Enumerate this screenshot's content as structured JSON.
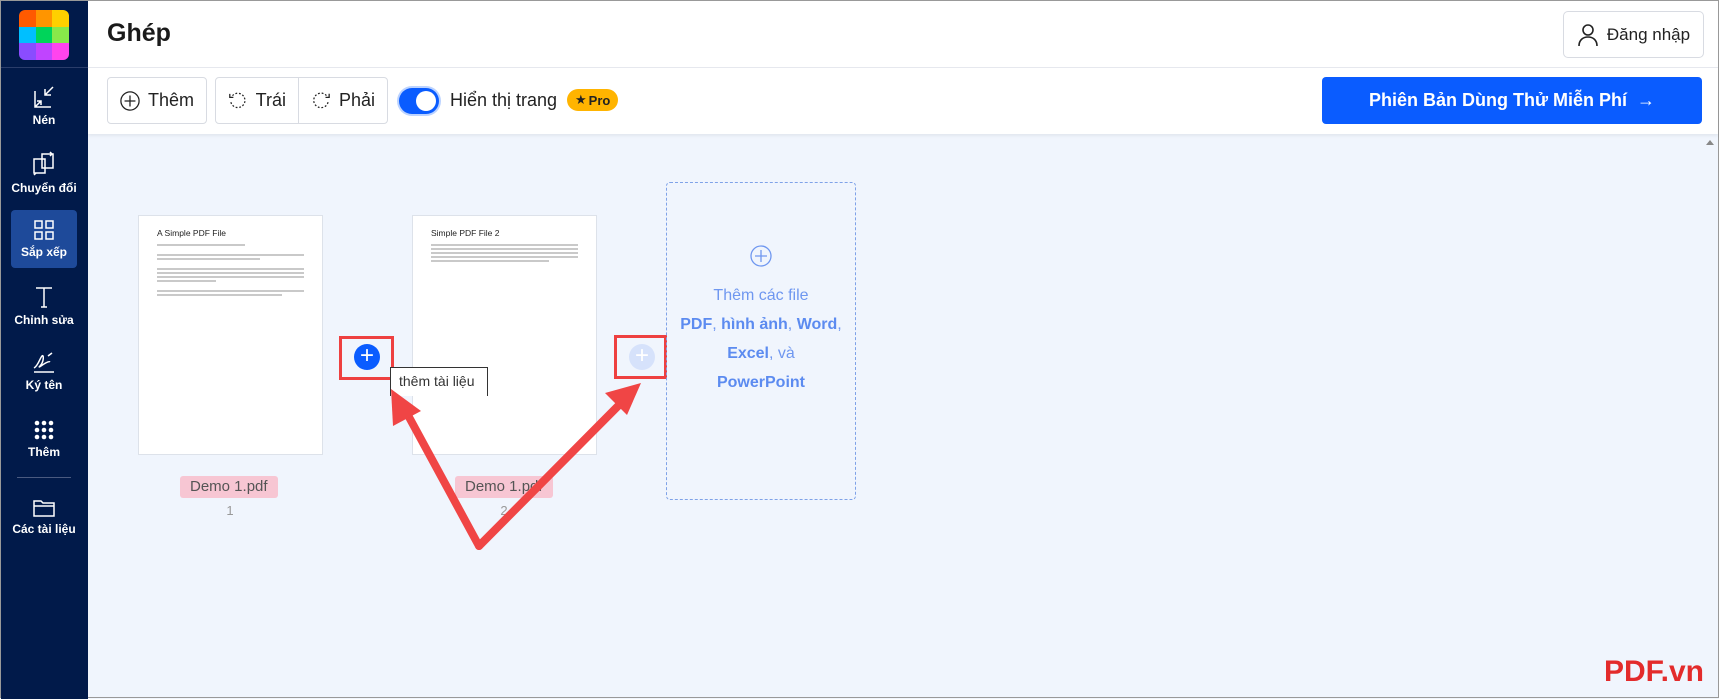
{
  "sidebar": {
    "items": [
      {
        "label": "Nén",
        "icon": "compress-icon"
      },
      {
        "label": "Chuyển đổi",
        "icon": "convert-icon"
      },
      {
        "label": "Sắp xếp",
        "icon": "grid-icon",
        "active": true
      },
      {
        "label": "Chỉnh sửa",
        "icon": "text-icon"
      },
      {
        "label": "Ký tên",
        "icon": "signature-icon"
      },
      {
        "label": "Thêm",
        "icon": "dots-grid-icon"
      },
      {
        "label": "Các tài liệu",
        "icon": "folder-icon"
      }
    ]
  },
  "header": {
    "title": "Ghép",
    "login": "Đăng nhập"
  },
  "toolbar": {
    "add": "Thêm",
    "left": "Trái",
    "right": "Phải",
    "show_pages": "Hiển thị trang",
    "show_pages_on": true,
    "pro": "Pro",
    "trial": "Phiên Bản Dùng Thử Miễn Phí"
  },
  "pages": [
    {
      "title": "A Simple PDF File",
      "file": "Demo 1.pdf",
      "number": "1"
    },
    {
      "title": "Simple PDF File 2",
      "file": "Demo 1.pdf",
      "number": "2"
    }
  ],
  "tooltip": "thêm tài liệu",
  "drop": {
    "line1": "Thêm các file",
    "pdf": "PDF",
    "sep1": ", ",
    "img": "hình ảnh",
    "sep2": ", ",
    "word": "Word",
    "sep3": ",",
    "excel": "Excel",
    "and": ", và",
    "ppt": "PowerPoint"
  },
  "watermark": "PDF.vn",
  "colors": {
    "sidebar": "#011a4a",
    "accent": "#0a5cff",
    "annotation": "#ee4040"
  }
}
